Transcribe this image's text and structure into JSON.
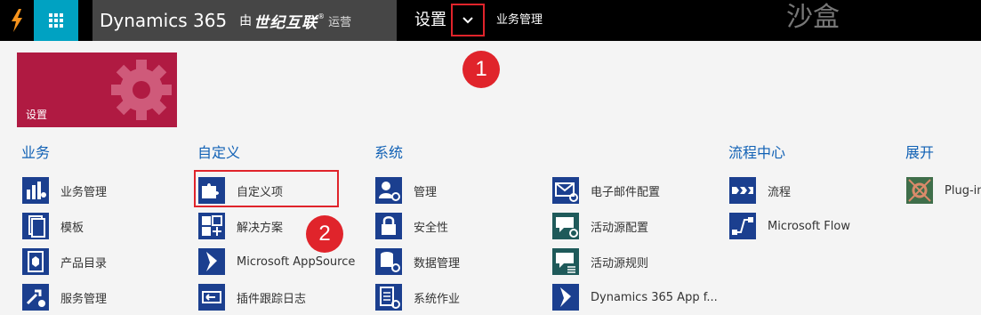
{
  "topbar": {
    "app_name": "Dynamics 365",
    "by_text": "由",
    "partner_name": "世纪互联",
    "partner_reg": "®",
    "operated": "运营",
    "nav_title": "设置",
    "breadcrumb": "业务管理",
    "environment": "沙盒"
  },
  "callouts": [
    "1",
    "2"
  ],
  "tile": {
    "label": "设置"
  },
  "groups": {
    "business": {
      "title": "业务",
      "items": [
        {
          "label": "业务管理",
          "icon": "business-management-icon"
        },
        {
          "label": "模板",
          "icon": "templates-icon"
        },
        {
          "label": "产品目录",
          "icon": "product-catalog-icon"
        },
        {
          "label": "服务管理",
          "icon": "service-management-icon"
        }
      ]
    },
    "customization": {
      "title": "自定义",
      "items": [
        {
          "label": "自定义项",
          "icon": "puzzle-icon"
        },
        {
          "label": "解决方案",
          "icon": "solutions-icon"
        },
        {
          "label": "Microsoft AppSource",
          "icon": "appsource-icon"
        },
        {
          "label": "插件跟踪日志",
          "icon": "plugin-trace-icon"
        }
      ]
    },
    "system": {
      "title": "系统",
      "items": [
        {
          "label": "管理",
          "icon": "administration-icon"
        },
        {
          "label": "安全性",
          "icon": "lock-icon"
        },
        {
          "label": "数据管理",
          "icon": "data-management-icon"
        },
        {
          "label": "系统作业",
          "icon": "system-jobs-icon"
        }
      ]
    },
    "system2": {
      "items": [
        {
          "label": "电子邮件配置",
          "icon": "email-config-icon"
        },
        {
          "label": "活动源配置",
          "icon": "activity-feed-config-icon"
        },
        {
          "label": "活动源规则",
          "icon": "activity-feed-rules-icon"
        },
        {
          "label": "Dynamics 365 App f...",
          "icon": "dynamics-app-icon"
        }
      ]
    },
    "process": {
      "title": "流程中心",
      "items": [
        {
          "label": "流程",
          "icon": "process-icon"
        },
        {
          "label": "Microsoft Flow",
          "icon": "flow-icon"
        }
      ]
    },
    "extensions": {
      "title": "展开",
      "items": [
        {
          "label": "Plug-in",
          "icon": "plugin-icon"
        }
      ]
    }
  },
  "colors": {
    "topbar": "#000000",
    "apps_tile": "#00a2c2",
    "brand_bg": "#464646",
    "settings_tile": "#b01a42",
    "group_title": "#1161b5",
    "icon_blue": "#1b3f8f",
    "icon_teal": "#1f5a5a",
    "callout": "#e0242b"
  }
}
